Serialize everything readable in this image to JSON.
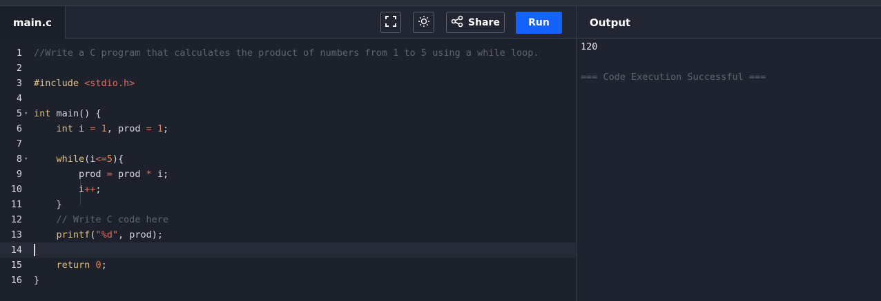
{
  "toolbar": {
    "file_tab": "main.c",
    "share_label": "Share",
    "run_label": "Run",
    "fullscreen_icon": "fullscreen-icon",
    "theme_icon": "sun-icon",
    "share_icon": "share-icon"
  },
  "output": {
    "title": "Output",
    "result": "120",
    "status": "=== Code Execution Successful ==="
  },
  "editor": {
    "active_line": 14,
    "lines": [
      {
        "num": "1",
        "fold": false,
        "tokens": [
          {
            "t": "comment",
            "v": "//Write a C program that calculates the product of numbers from 1 to 5 using a while loop."
          }
        ]
      },
      {
        "num": "2",
        "fold": false,
        "tokens": []
      },
      {
        "num": "3",
        "fold": false,
        "tokens": [
          {
            "t": "kw",
            "v": "#include "
          },
          {
            "t": "str",
            "v": "<stdio.h>"
          }
        ]
      },
      {
        "num": "4",
        "fold": false,
        "tokens": []
      },
      {
        "num": "5",
        "fold": true,
        "tokens": [
          {
            "t": "kw",
            "v": "int"
          },
          {
            "t": "plain",
            "v": " main() {"
          }
        ]
      },
      {
        "num": "6",
        "fold": false,
        "tokens": [
          {
            "t": "plain",
            "v": "    "
          },
          {
            "t": "kw",
            "v": "int"
          },
          {
            "t": "plain",
            "v": " i "
          },
          {
            "t": "op",
            "v": "="
          },
          {
            "t": "plain",
            "v": " "
          },
          {
            "t": "num",
            "v": "1"
          },
          {
            "t": "plain",
            "v": ", prod "
          },
          {
            "t": "op",
            "v": "="
          },
          {
            "t": "plain",
            "v": " "
          },
          {
            "t": "num",
            "v": "1"
          },
          {
            "t": "plain",
            "v": ";"
          }
        ]
      },
      {
        "num": "7",
        "fold": false,
        "tokens": []
      },
      {
        "num": "8",
        "fold": true,
        "tokens": [
          {
            "t": "plain",
            "v": "    "
          },
          {
            "t": "kw",
            "v": "while"
          },
          {
            "t": "plain",
            "v": "(i"
          },
          {
            "t": "op",
            "v": "<="
          },
          {
            "t": "num",
            "v": "5"
          },
          {
            "t": "plain",
            "v": "){"
          }
        ]
      },
      {
        "num": "9",
        "fold": false,
        "tokens": [
          {
            "t": "plain",
            "v": "        prod "
          },
          {
            "t": "op",
            "v": "="
          },
          {
            "t": "plain",
            "v": " prod "
          },
          {
            "t": "op",
            "v": "*"
          },
          {
            "t": "plain",
            "v": " i;"
          }
        ]
      },
      {
        "num": "10",
        "fold": false,
        "tokens": [
          {
            "t": "plain",
            "v": "        i"
          },
          {
            "t": "op",
            "v": "++"
          },
          {
            "t": "plain",
            "v": ";"
          }
        ]
      },
      {
        "num": "11",
        "fold": false,
        "tokens": [
          {
            "t": "plain",
            "v": "    }"
          }
        ]
      },
      {
        "num": "12",
        "fold": false,
        "tokens": [
          {
            "t": "plain",
            "v": "    "
          },
          {
            "t": "comment",
            "v": "// Write C code here"
          }
        ]
      },
      {
        "num": "13",
        "fold": false,
        "tokens": [
          {
            "t": "plain",
            "v": "    "
          },
          {
            "t": "kw",
            "v": "printf"
          },
          {
            "t": "plain",
            "v": "("
          },
          {
            "t": "str",
            "v": "\"%d\""
          },
          {
            "t": "plain",
            "v": ", prod);"
          }
        ]
      },
      {
        "num": "14",
        "fold": false,
        "tokens": []
      },
      {
        "num": "15",
        "fold": false,
        "tokens": [
          {
            "t": "plain",
            "v": "    "
          },
          {
            "t": "kw",
            "v": "return"
          },
          {
            "t": "plain",
            "v": " "
          },
          {
            "t": "num",
            "v": "0"
          },
          {
            "t": "plain",
            "v": ";"
          }
        ]
      },
      {
        "num": "16",
        "fold": false,
        "tokens": [
          {
            "t": "plain",
            "v": "}"
          }
        ]
      }
    ]
  }
}
